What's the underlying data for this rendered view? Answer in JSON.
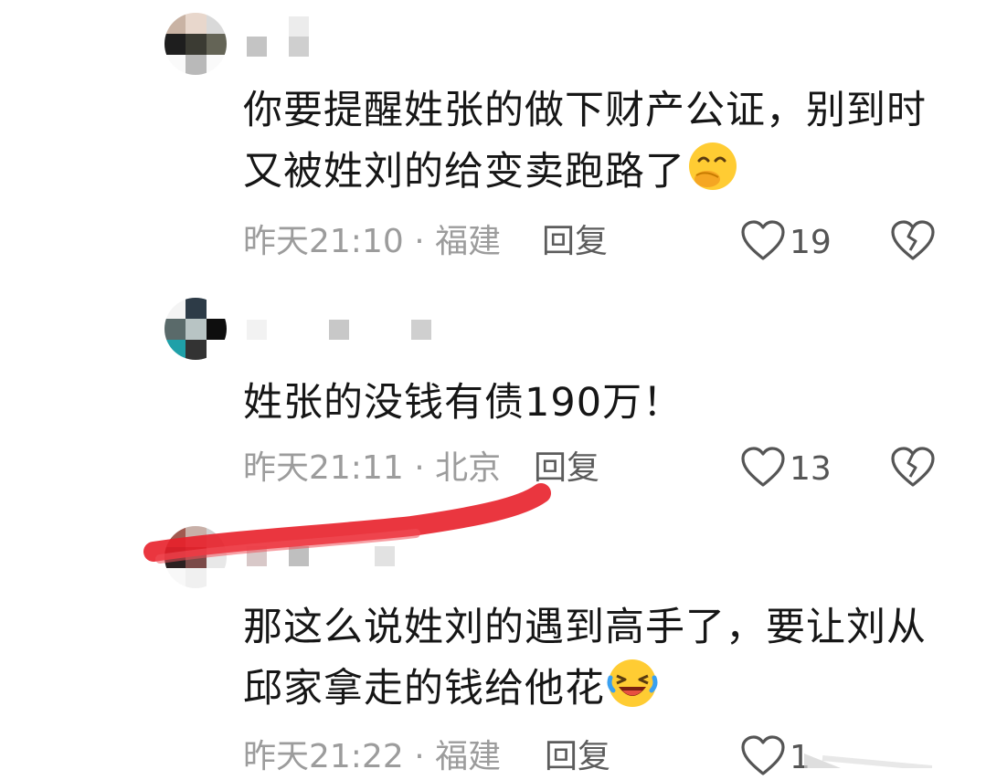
{
  "comments": [
    {
      "text_line1": "你要提醒姓张的做下财产公证，别到时",
      "text_line2": "又被姓刘的给变卖跑路了",
      "emoji": "face-with-hand-over-mouth-emoji",
      "time": "昨天21:10",
      "location": "福建",
      "reply_label": "回复",
      "likes": "19"
    },
    {
      "text_line1": "姓张的没钱有债190万！",
      "time": "昨天21:11",
      "location": "北京",
      "reply_label": "回复",
      "likes": "13"
    },
    {
      "text_line1": "那这么说姓刘的遇到高手了，要让刘从",
      "text_line2": "邱家拿走的钱给他花",
      "emoji": "rolling-on-floor-laughing-emoji",
      "time": "昨天21:22",
      "location": "福建",
      "reply_label": "回复",
      "likes": "1"
    }
  ],
  "separator": " · ",
  "icons": {
    "like": "heart-outline-icon",
    "dislike": "broken-heart-icon"
  },
  "colors": {
    "text": "#161616",
    "meta": "#9c9c9c",
    "reply": "#5c5c5c",
    "annotation": "#e8202a"
  }
}
